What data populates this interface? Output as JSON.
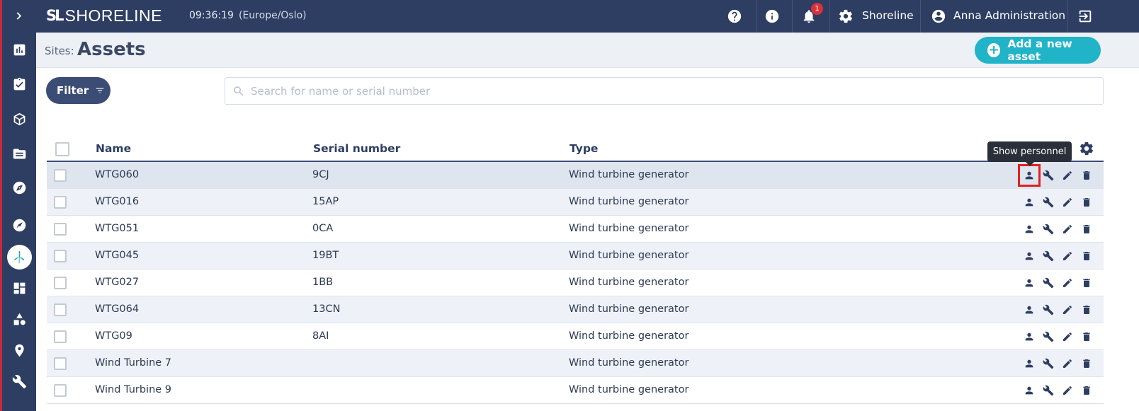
{
  "app": {
    "logo_mark": "SL",
    "logo_text": "SHORELINE",
    "time": "09:36:19",
    "timezone": "(Europe/Oslo)",
    "notification_count": "1",
    "tenant": "Shoreline",
    "user": "Anna Administration"
  },
  "sidebar": {
    "items": [
      {
        "icon": "chevron-right-icon"
      },
      {
        "icon": "bar-chart-icon"
      },
      {
        "icon": "clipboard-check-icon"
      },
      {
        "icon": "cube-icon"
      },
      {
        "icon": "folder-icon"
      },
      {
        "icon": "compass-icon"
      },
      {
        "icon": "compass-outline-icon"
      },
      {
        "icon": "wind-turbine-icon",
        "active": true
      },
      {
        "icon": "dashboard-icon"
      },
      {
        "icon": "shapes-icon"
      },
      {
        "icon": "map-pin-icon"
      },
      {
        "icon": "wrench-icon"
      }
    ]
  },
  "header": {
    "breadcrumb": "Sites:",
    "title": "Assets",
    "add_button": "Add a new asset"
  },
  "toolbar": {
    "filter_label": "Filter",
    "search_placeholder": "Search for name or serial number"
  },
  "table": {
    "columns": {
      "name": "Name",
      "serial": "Serial number",
      "type": "Type"
    },
    "tooltip": "Show personnel",
    "rows": [
      {
        "name": "WTG060",
        "serial": "9CJ",
        "type": "Wind turbine generator"
      },
      {
        "name": "WTG016",
        "serial": "15AP",
        "type": "Wind turbine generator"
      },
      {
        "name": "WTG051",
        "serial": "0CA",
        "type": "Wind turbine generator"
      },
      {
        "name": "WTG045",
        "serial": "19BT",
        "type": "Wind turbine generator"
      },
      {
        "name": "WTG027",
        "serial": "1BB",
        "type": "Wind turbine generator"
      },
      {
        "name": "WTG064",
        "serial": "13CN",
        "type": "Wind turbine generator"
      },
      {
        "name": "WTG09",
        "serial": "8AI",
        "type": "Wind turbine generator"
      },
      {
        "name": "Wind Turbine 7",
        "serial": "",
        "type": "Wind turbine generator"
      },
      {
        "name": "Wind Turbine 9",
        "serial": "",
        "type": "Wind turbine generator"
      }
    ]
  },
  "colors": {
    "navy": "#2e3e63",
    "accent_teal": "#21b3c7",
    "badge_red": "#d8323c",
    "highlight_red": "#e02020"
  }
}
